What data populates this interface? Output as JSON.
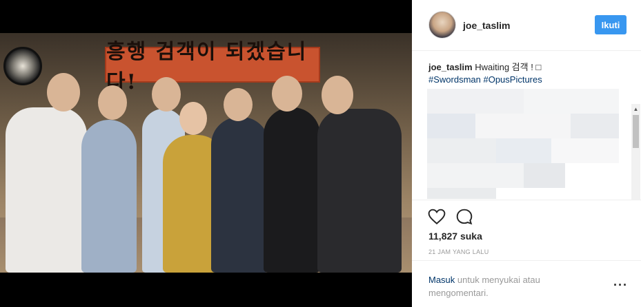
{
  "post": {
    "username": "joe_taslim",
    "follow_label": "Ikuti",
    "photo_banner_text": "흥행 검객이 되겠습니다!",
    "caption_user": "joe_taslim",
    "caption_text": " Hwaiting 검객 ! □",
    "caption_tags": "#Swordsman #OpusPictures",
    "likes_count": "11,827",
    "likes_label": " suka",
    "timestamp": "21 JAM YANG LALU",
    "login_link": "Masuk",
    "login_text": " untuk menyukai atau mengomentari."
  },
  "icons": {
    "like": "heart-outline-icon",
    "comment": "comment-bubble-icon",
    "more": "more-options-icon",
    "scroll_up": "chevron-up-icon",
    "scroll_down": "chevron-down-icon"
  },
  "colors": {
    "follow_button": "#3897f0",
    "hashtag": "#003569",
    "muted": "#999999"
  }
}
